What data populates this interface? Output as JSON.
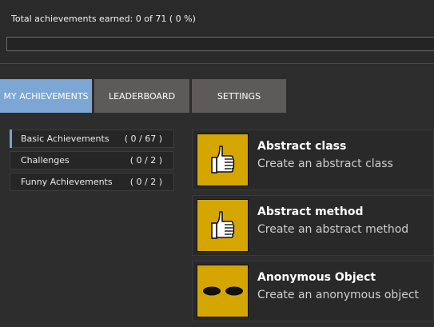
{
  "summary": {
    "text": "Total achievements earned: 0 of 71 ( 0 %)",
    "progress_fraction": 0
  },
  "tabs": [
    {
      "label": "MY ACHIEVEMENTS",
      "active": true
    },
    {
      "label": "LEADERBOARD",
      "active": false
    },
    {
      "label": "SETTINGS",
      "active": false
    }
  ],
  "categories": [
    {
      "label": "Basic Achievements",
      "count": "( 0 / 67 )",
      "active": true
    },
    {
      "label": "Challenges",
      "count": "( 0 / 2 )",
      "active": false
    },
    {
      "label": "Funny Achievements",
      "count": "( 0 / 2 )",
      "active": false
    }
  ],
  "achievements": [
    {
      "title": "Abstract class",
      "description": "Create an abstract class",
      "icon": "thumbs-up-icon"
    },
    {
      "title": "Abstract method",
      "description": "Create an abstract method",
      "icon": "thumbs-up-icon"
    },
    {
      "title": "Anonymous Object",
      "description": "Create an anonymous object",
      "icon": "eyes-icon"
    }
  ],
  "colors": {
    "background": "#2d2d2d",
    "tab_active": "#7ca6d3",
    "tab_inactive": "#5d5b5a",
    "achievement_icon_bg": "#d6a600"
  }
}
